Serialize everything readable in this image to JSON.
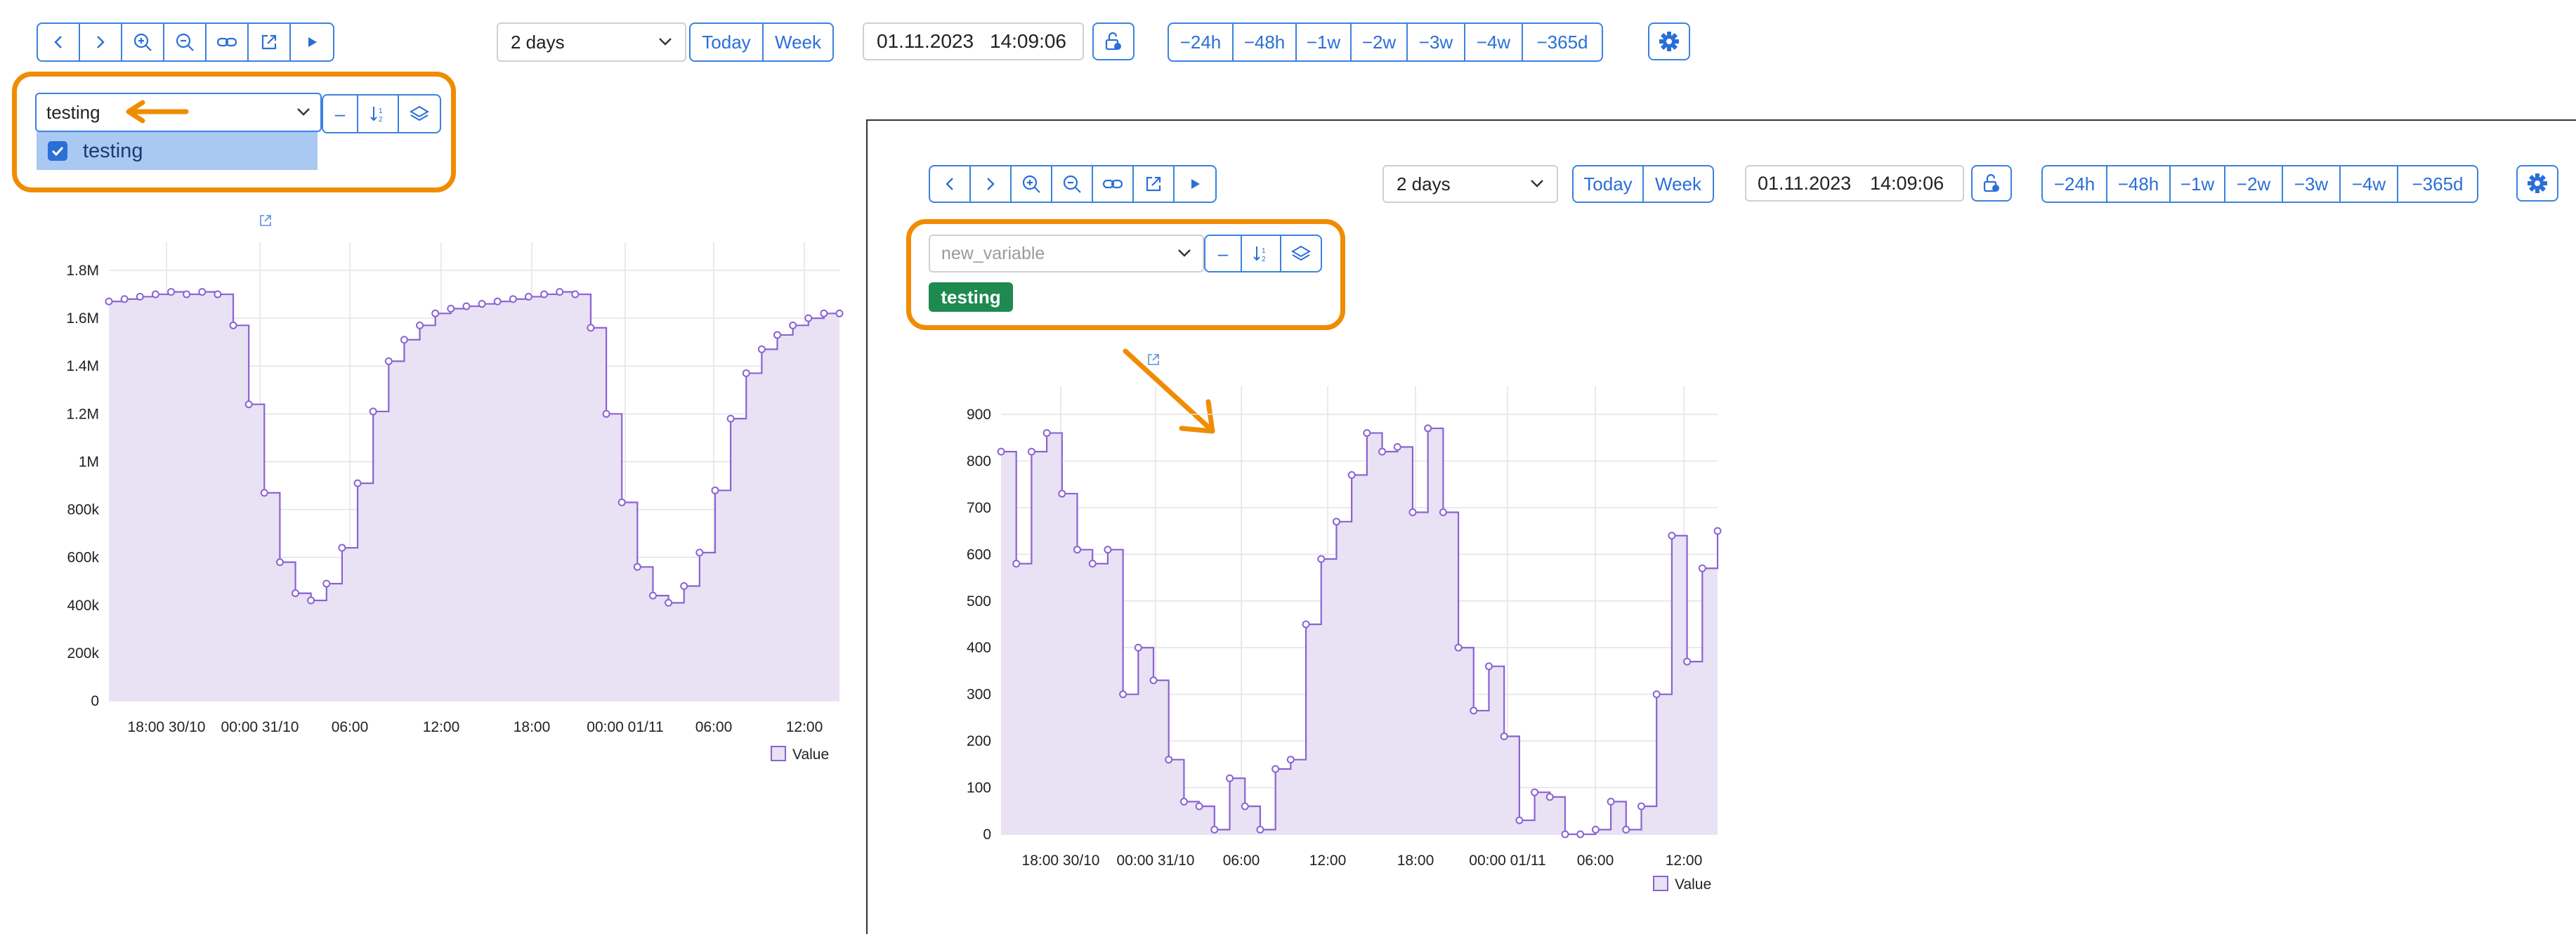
{
  "toolbar": {
    "nav_buttons": [
      "prev",
      "next",
      "zoom-in",
      "zoom-out",
      "link",
      "external",
      "play"
    ],
    "range_select": "2 days",
    "today_label": "Today",
    "week_label": "Week",
    "date_value": "01.11.2023",
    "time_value": "14:09:06",
    "shift_buttons": [
      "−24h",
      "−48h",
      "−1w",
      "−2w",
      "−3w",
      "−4w",
      "−365d"
    ]
  },
  "left_panel": {
    "variable_value": "testing",
    "dropdown_option": "testing",
    "dropdown_checked": true
  },
  "right_panel": {
    "variable_placeholder": "new_variable",
    "tag_label": "testing"
  },
  "colors": {
    "accent": "#3b82e0",
    "annotation": "#f08c00",
    "series_line": "#8a63d2",
    "series_fill": "#e9e1f4",
    "tag": "#1e8a4f"
  },
  "chart_data": [
    {
      "type": "area",
      "step": true,
      "y_tick_labels": [
        "0",
        "200k",
        "400k",
        "600k",
        "800k",
        "1M",
        "1.2M",
        "1.4M",
        "1.6M",
        "1.8M"
      ],
      "ylim": [
        0,
        1800000
      ],
      "x_tick_labels": [
        "18:00 30/10",
        "00:00 31/10",
        "06:00",
        "12:00",
        "18:00",
        "00:00 01/11",
        "06:00",
        "12:00"
      ],
      "legend": [
        "Value"
      ],
      "series": [
        {
          "name": "Value",
          "values": [
            1670000,
            1680000,
            1690000,
            1700000,
            1710000,
            1700000,
            1710000,
            1700000,
            1570000,
            1240000,
            870000,
            580000,
            450000,
            420000,
            490000,
            640000,
            910000,
            1210000,
            1420000,
            1510000,
            1570000,
            1620000,
            1640000,
            1650000,
            1660000,
            1670000,
            1680000,
            1690000,
            1700000,
            1710000,
            1700000,
            1560000,
            1200000,
            830000,
            560000,
            440000,
            410000,
            480000,
            620000,
            880000,
            1180000,
            1370000,
            1470000,
            1530000,
            1570000,
            1600000,
            1620000,
            1620000
          ]
        }
      ]
    },
    {
      "type": "area",
      "step": true,
      "y_tick_labels": [
        "0",
        "100",
        "200",
        "300",
        "400",
        "500",
        "600",
        "700",
        "800",
        "900"
      ],
      "ylim": [
        0,
        900
      ],
      "x_tick_labels": [
        "18:00 30/10",
        "00:00 31/10",
        "06:00",
        "12:00",
        "18:00",
        "00:00 01/11",
        "06:00",
        "12:00"
      ],
      "legend": [
        "Value"
      ],
      "series": [
        {
          "name": "Value",
          "values": [
            820,
            580,
            820,
            860,
            730,
            610,
            580,
            610,
            300,
            400,
            330,
            160,
            70,
            60,
            10,
            120,
            60,
            10,
            140,
            160,
            450,
            590,
            670,
            770,
            860,
            820,
            830,
            690,
            870,
            690,
            400,
            265,
            360,
            210,
            30,
            90,
            80,
            0,
            0,
            10,
            70,
            10,
            60,
            300,
            640,
            370,
            570,
            650
          ]
        }
      ]
    }
  ]
}
